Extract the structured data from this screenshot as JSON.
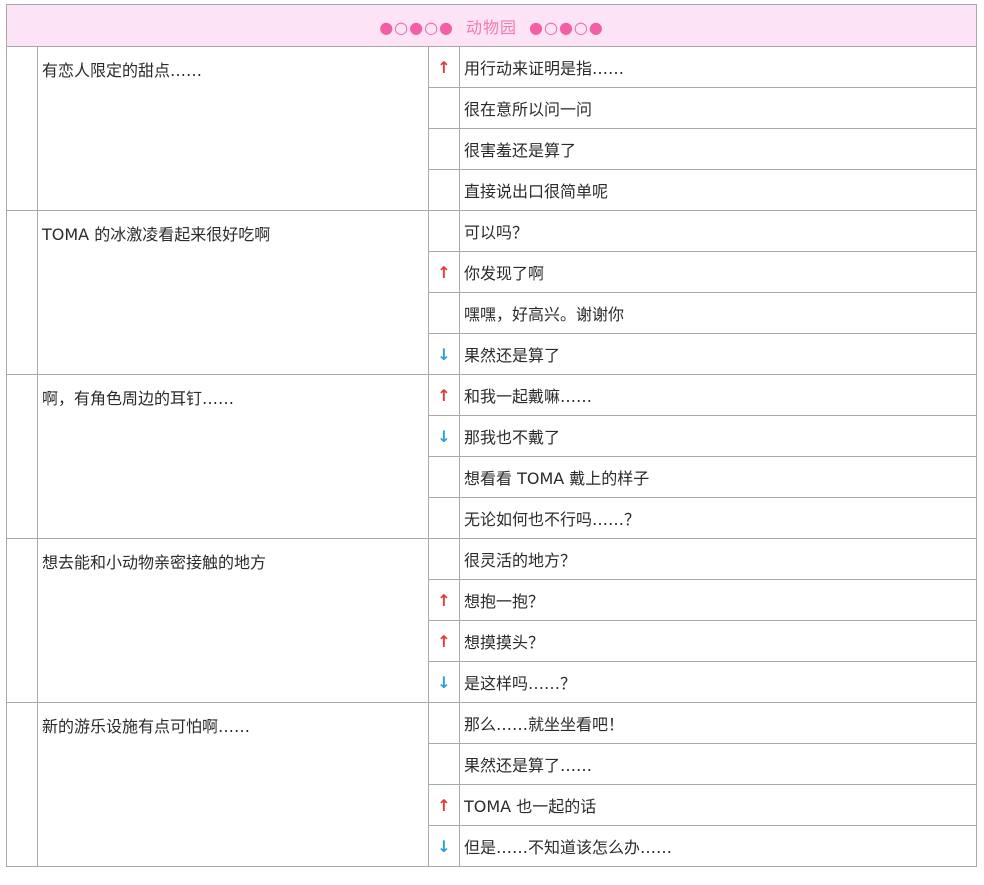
{
  "header": {
    "left_dots": "●○●○●",
    "title": "动物园",
    "right_dots": "●○●○●"
  },
  "arrow_glyphs": {
    "up": "↑",
    "down": "↓",
    "none": ""
  },
  "colors": {
    "header_bg": "#fde3f6",
    "header_text": "#f37ab0",
    "up_arrow": "#e53935",
    "down_arrow": "#2a9fd6",
    "border": "#a9a9a9"
  },
  "groups": [
    {
      "question": "有恋人限定的甜点……",
      "answers": [
        {
          "arrow": "up",
          "text": "用行动来证明是指……"
        },
        {
          "arrow": "none",
          "text": "很在意所以问一问"
        },
        {
          "arrow": "none",
          "text": "很害羞还是算了"
        },
        {
          "arrow": "none",
          "text": "直接说出口很简单呢"
        }
      ]
    },
    {
      "question": "TOMA 的冰激凌看起来很好吃啊",
      "answers": [
        {
          "arrow": "none",
          "text": "可以吗？"
        },
        {
          "arrow": "up",
          "text": "你发现了啊"
        },
        {
          "arrow": "none",
          "text": "嘿嘿，好高兴。谢谢你"
        },
        {
          "arrow": "down",
          "text": "果然还是算了"
        }
      ]
    },
    {
      "question": "啊，有角色周边的耳钉……",
      "answers": [
        {
          "arrow": "up",
          "text": "和我一起戴嘛……"
        },
        {
          "arrow": "down",
          "text": "那我也不戴了"
        },
        {
          "arrow": "none",
          "text": "想看看 TOMA 戴上的样子"
        },
        {
          "arrow": "none",
          "text": "无论如何也不行吗……？"
        }
      ]
    },
    {
      "question": "想去能和小动物亲密接触的地方",
      "answers": [
        {
          "arrow": "none",
          "text": "很灵活的地方？"
        },
        {
          "arrow": "up",
          "text": "想抱一抱？"
        },
        {
          "arrow": "up",
          "text": "想摸摸头？"
        },
        {
          "arrow": "down",
          "text": "是这样吗……？"
        }
      ]
    },
    {
      "question": "新的游乐设施有点可怕啊……",
      "answers": [
        {
          "arrow": "none",
          "text": "那么……就坐坐看吧！"
        },
        {
          "arrow": "none",
          "text": "果然还是算了……"
        },
        {
          "arrow": "up",
          "text": "TOMA 也一起的话"
        },
        {
          "arrow": "down",
          "text": "但是……不知道该怎么办……"
        }
      ]
    }
  ]
}
